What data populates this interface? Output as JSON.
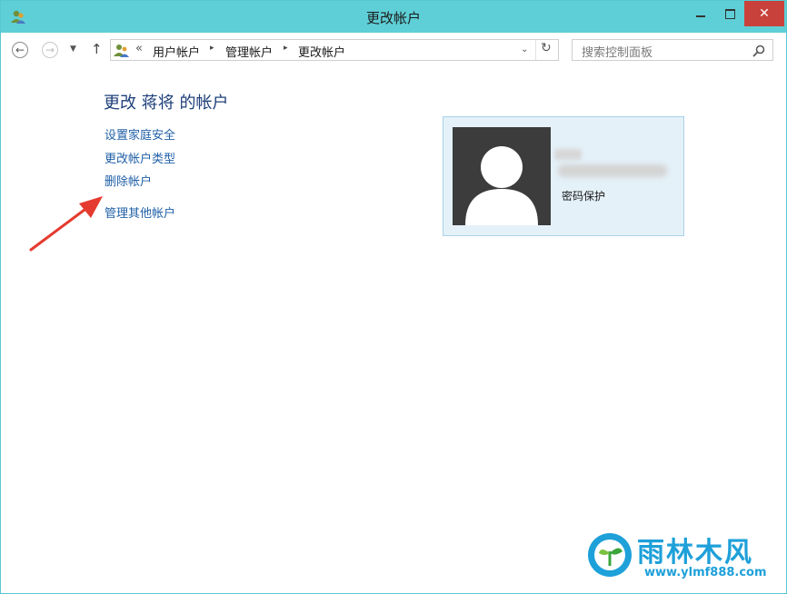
{
  "window": {
    "title": "更改帐户",
    "close_glyph": "✕",
    "accent_color": "#5ecfd6",
    "close_color": "#c9413b"
  },
  "nav": {
    "back_icon": "arrow-left",
    "forward_icon": "arrow-right",
    "up_icon": "arrow-up",
    "back_glyph": "←",
    "forward_glyph": "→",
    "dropdown_glyph": "▼",
    "up_glyph": "↑",
    "address_overflow": "«",
    "breadcrumbs": [
      "用户帐户",
      "管理帐户",
      "更改帐户"
    ],
    "crumb_sep": "▸",
    "address_dropdown_glyph": "⌄",
    "refresh_glyph": "↻",
    "search_placeholder": "搜索控制面板"
  },
  "main": {
    "heading": "更改 蒋将 的帐户",
    "links": [
      "设置家庭安全",
      "更改帐户类型",
      "删除帐户",
      "管理其他帐户"
    ],
    "link_color": "#1f5fa6"
  },
  "account": {
    "status": "密码保护",
    "card_color": "#e4f1f8",
    "avatar_color": "#3c3c3c"
  },
  "watermark": {
    "title": "雨林木风",
    "url": "www.ylmf888.com",
    "color": "#1ea0d9"
  }
}
